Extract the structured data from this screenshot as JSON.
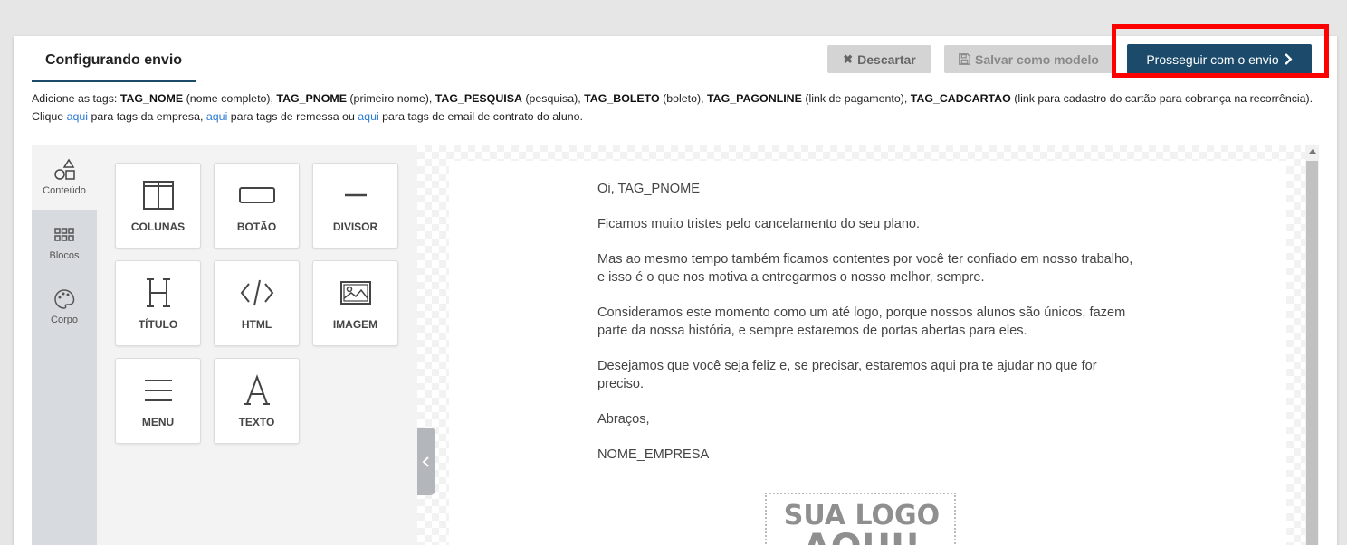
{
  "header": {
    "tab_label": "Configurando envio",
    "discard_label": "Descartar",
    "save_label": "Salvar como modelo",
    "proceed_label": "Prosseguir com o envio"
  },
  "tags_info": {
    "prefix": "Adicione as tags: ",
    "tags": [
      {
        "name": "TAG_NOME",
        "desc": " (nome completo), "
      },
      {
        "name": "TAG_PNOME",
        "desc": " (primeiro nome), "
      },
      {
        "name": "TAG_PESQUISA",
        "desc": " (pesquisa), "
      },
      {
        "name": "TAG_BOLETO",
        "desc": " (boleto), "
      },
      {
        "name": "TAG_PAGONLINE",
        "desc": " (link de pagamento), "
      },
      {
        "name": "TAG_CADCARTAO",
        "desc": " (link para cadastro do cartão para cobrança na recorrência). Clique "
      }
    ],
    "link_label": "aqui",
    "text_company": " para tags da empresa, ",
    "text_remessa": " para tags de remessa ou ",
    "text_contract": " para tags de email de contrato do aluno."
  },
  "side_nav": {
    "items": [
      {
        "label": "Conteúdo",
        "icon": "shapes-icon"
      },
      {
        "label": "Blocos",
        "icon": "grid-icon"
      },
      {
        "label": "Corpo",
        "icon": "palette-icon"
      }
    ]
  },
  "tools": [
    {
      "label": "COLUNAS",
      "icon": "columns-icon"
    },
    {
      "label": "BOTÃO",
      "icon": "button-icon"
    },
    {
      "label": "DIVISOR",
      "icon": "divider-icon"
    },
    {
      "label": "TÍTULO",
      "icon": "heading-icon"
    },
    {
      "label": "HTML",
      "icon": "code-icon"
    },
    {
      "label": "IMAGEM",
      "icon": "image-icon"
    },
    {
      "label": "MENU",
      "icon": "menu-icon"
    },
    {
      "label": "TEXTO",
      "icon": "text-icon"
    }
  ],
  "email": {
    "paragraphs": [
      "Oi, TAG_PNOME",
      "Ficamos muito tristes pelo cancelamento do seu plano.",
      "Mas ao mesmo tempo também ficamos contentes por você ter confiado em nosso trabalho, e isso é o que nos motiva a entregarmos o nosso melhor, sempre.",
      "Consideramos este momento como um até logo, porque nossos alunos são únicos, fazem parte da nossa história, e sempre estaremos de portas abertas para eles.",
      "Desejamos que você seja feliz e, se precisar, estaremos aqui pra te ajudar no que for preciso.",
      "Abraços,",
      "NOME_EMPRESA"
    ],
    "logo_text": "SUA LOGO AQUI!"
  },
  "colors": {
    "primary": "#1b4a6b",
    "highlight": "#ff0000",
    "link": "#2a7bd4"
  }
}
